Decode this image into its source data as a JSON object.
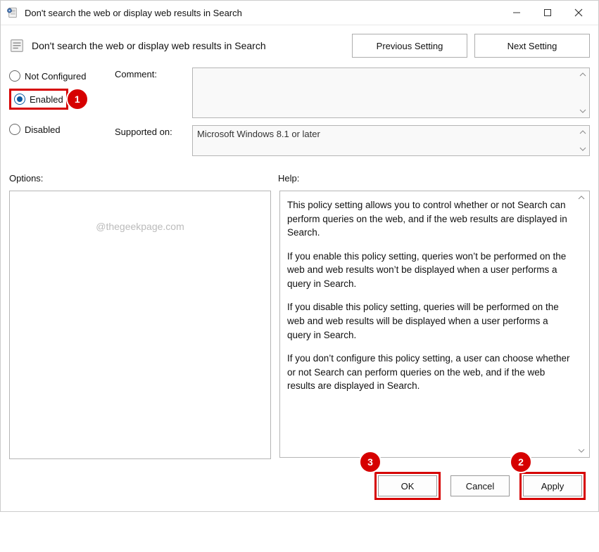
{
  "window": {
    "title": "Don't search the web or display web results in Search"
  },
  "header": {
    "title": "Don't search the web or display web results in Search",
    "prev_btn": "Previous Setting",
    "next_btn": "Next Setting"
  },
  "state": {
    "not_configured": "Not Configured",
    "enabled": "Enabled",
    "disabled": "Disabled"
  },
  "fields": {
    "comment_label": "Comment:",
    "comment_value": "",
    "supported_label": "Supported on:",
    "supported_value": "Microsoft Windows 8.1 or later"
  },
  "labels": {
    "options": "Options:",
    "help": "Help:"
  },
  "help": {
    "p1": "This policy setting allows you to control whether or not Search can perform queries on the web, and if the web results are displayed in Search.",
    "p2": "If you enable this policy setting, queries won’t be performed on the web and web results won’t be displayed when a user performs a query in Search.",
    "p3": "If you disable this policy setting, queries will be performed on the web and web results will be displayed when a user performs a query in Search.",
    "p4": "If you don’t configure this policy setting, a user can choose whether or not Search can perform queries on the web, and if the web results are displayed in Search."
  },
  "footer": {
    "ok": "OK",
    "cancel": "Cancel",
    "apply": "Apply"
  },
  "watermark": "@thegeekpage.com",
  "markers": {
    "m1": "1",
    "m2": "2",
    "m3": "3"
  }
}
